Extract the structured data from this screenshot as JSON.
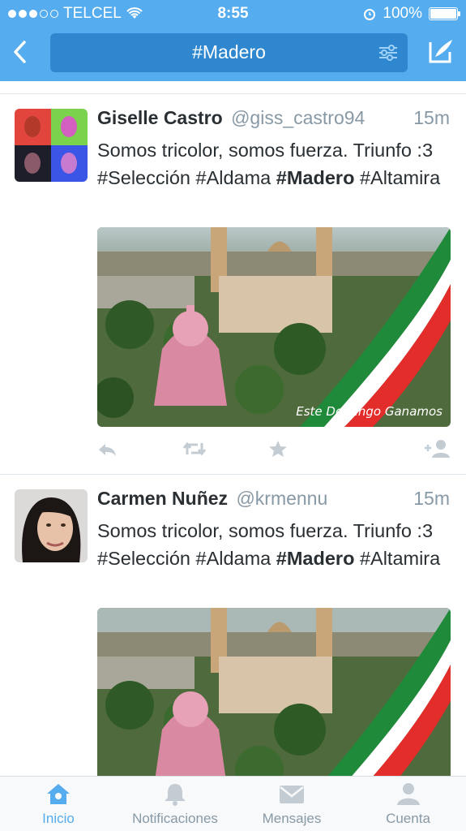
{
  "status": {
    "carrier": "TELCEL",
    "time": "8:55",
    "battery": "100%",
    "signal_dots_filled": 3,
    "signal_dots_total": 5
  },
  "nav": {
    "search_query": "#Madero"
  },
  "tweets": [
    {
      "name": "Giselle Castro",
      "handle": "@giss_castro94",
      "time": "15m",
      "text_parts": [
        "Somos tricolor, somos fuerza. Triunfo :3 #Selección #Aldama ",
        "#Madero",
        " #Altamira"
      ],
      "media_caption": "Este Domingo Ganamos"
    },
    {
      "name": "Carmen Nuñez",
      "handle": "@krmennu",
      "time": "15m",
      "text_parts": [
        "Somos tricolor, somos fuerza. Triunfo :3 #Selección #Aldama ",
        "#Madero",
        " #Altamira"
      ],
      "media_caption": ""
    }
  ],
  "tabs": [
    {
      "label": "Inicio",
      "icon": "home-icon",
      "active": true
    },
    {
      "label": "Notificaciones",
      "icon": "bell-icon",
      "active": false
    },
    {
      "label": "Mensajes",
      "icon": "envelope-icon",
      "active": false
    },
    {
      "label": "Cuenta",
      "icon": "person-icon",
      "active": false
    }
  ],
  "colors": {
    "brand": "#55acee",
    "search_bar": "#2f88cf",
    "secondary_text": "#8899a6",
    "action_icon": "#c4ccd3"
  }
}
